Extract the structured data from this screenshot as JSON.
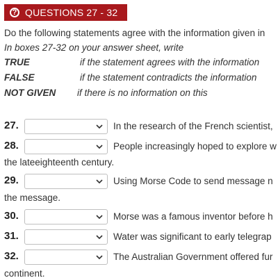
{
  "header": {
    "icon": "question-circle-icon",
    "title": "QUESTIONS 27 - 32",
    "background": "#a8191d"
  },
  "instructions": {
    "line1": "Do the following statements agree with the information given in",
    "line2": "In boxes 27-32 on your answer sheet, write"
  },
  "legend": [
    {
      "key": "TRUE",
      "desc": "if the statement agrees with the information"
    },
    {
      "key": "FALSE",
      "desc": "if the statement contradicts the information"
    },
    {
      "key": "NOT GIVEN",
      "desc": "if there is no information on this"
    }
  ],
  "questions": [
    {
      "number": "27.",
      "selected": "",
      "text": "In the research of the French scientist,",
      "continuation": ""
    },
    {
      "number": "28.",
      "selected": "",
      "text": "People increasingly hoped to explore w",
      "continuation": "the lateeighteenth century."
    },
    {
      "number": "29.",
      "selected": "",
      "text": "Using Morse Code to send message n",
      "continuation": "the message."
    },
    {
      "number": "30.",
      "selected": "",
      "text": "Morse was a famous inventor before h",
      "continuation": ""
    },
    {
      "number": "31.",
      "selected": "",
      "text": "Water was significant to early telegrap",
      "continuation": ""
    },
    {
      "number": "32.",
      "selected": "",
      "text": "The Australian Government offered fur",
      "continuation": "continent."
    }
  ]
}
